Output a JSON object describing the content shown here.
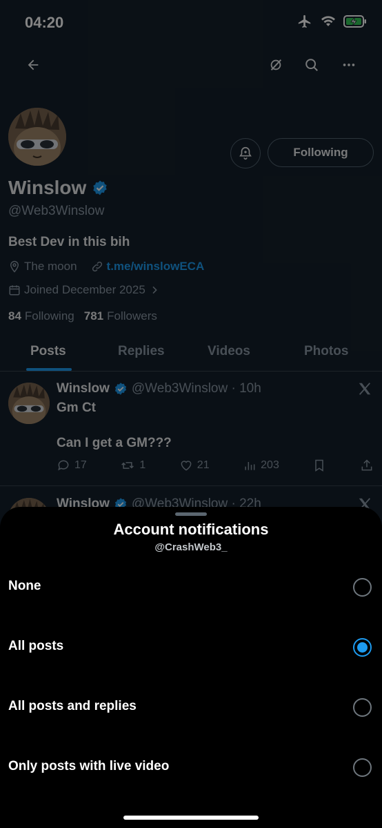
{
  "status_bar": {
    "time": "04:20"
  },
  "profile": {
    "name": "Winslow",
    "handle": "@Web3Winslow",
    "bio": "Best Dev in this bih",
    "location": "The moon",
    "link": "t.me/winslowECA",
    "joined": "Joined December 2025",
    "following_count": "84",
    "following_label": "Following",
    "followers_count": "781",
    "followers_label": "Followers",
    "follow_button": "Following"
  },
  "tabs": [
    {
      "label": "Posts",
      "active": true
    },
    {
      "label": "Replies"
    },
    {
      "label": "Videos"
    },
    {
      "label": "Photos"
    }
  ],
  "posts": [
    {
      "name": "Winslow",
      "handle_time": "@Web3Winslow · 10h",
      "line1": "Gm Ct",
      "line2": "Can I get a GM???",
      "replies": "17",
      "reposts": "1",
      "likes": "21",
      "views": "203"
    },
    {
      "name": "Winslow",
      "handle_time": "@Web3Winslow · 22h"
    }
  ],
  "sheet": {
    "title": "Account notifications",
    "subtitle": "@CrashWeb3_",
    "options": [
      {
        "label": "None",
        "selected": false
      },
      {
        "label": "All posts",
        "selected": true
      },
      {
        "label": "All posts and replies",
        "selected": false
      },
      {
        "label": "Only posts with live video",
        "selected": false
      }
    ]
  },
  "colors": {
    "accent": "#1d9bf0",
    "background": "#15202b",
    "sheet": "#000000",
    "verified": "#1d9bf0"
  }
}
